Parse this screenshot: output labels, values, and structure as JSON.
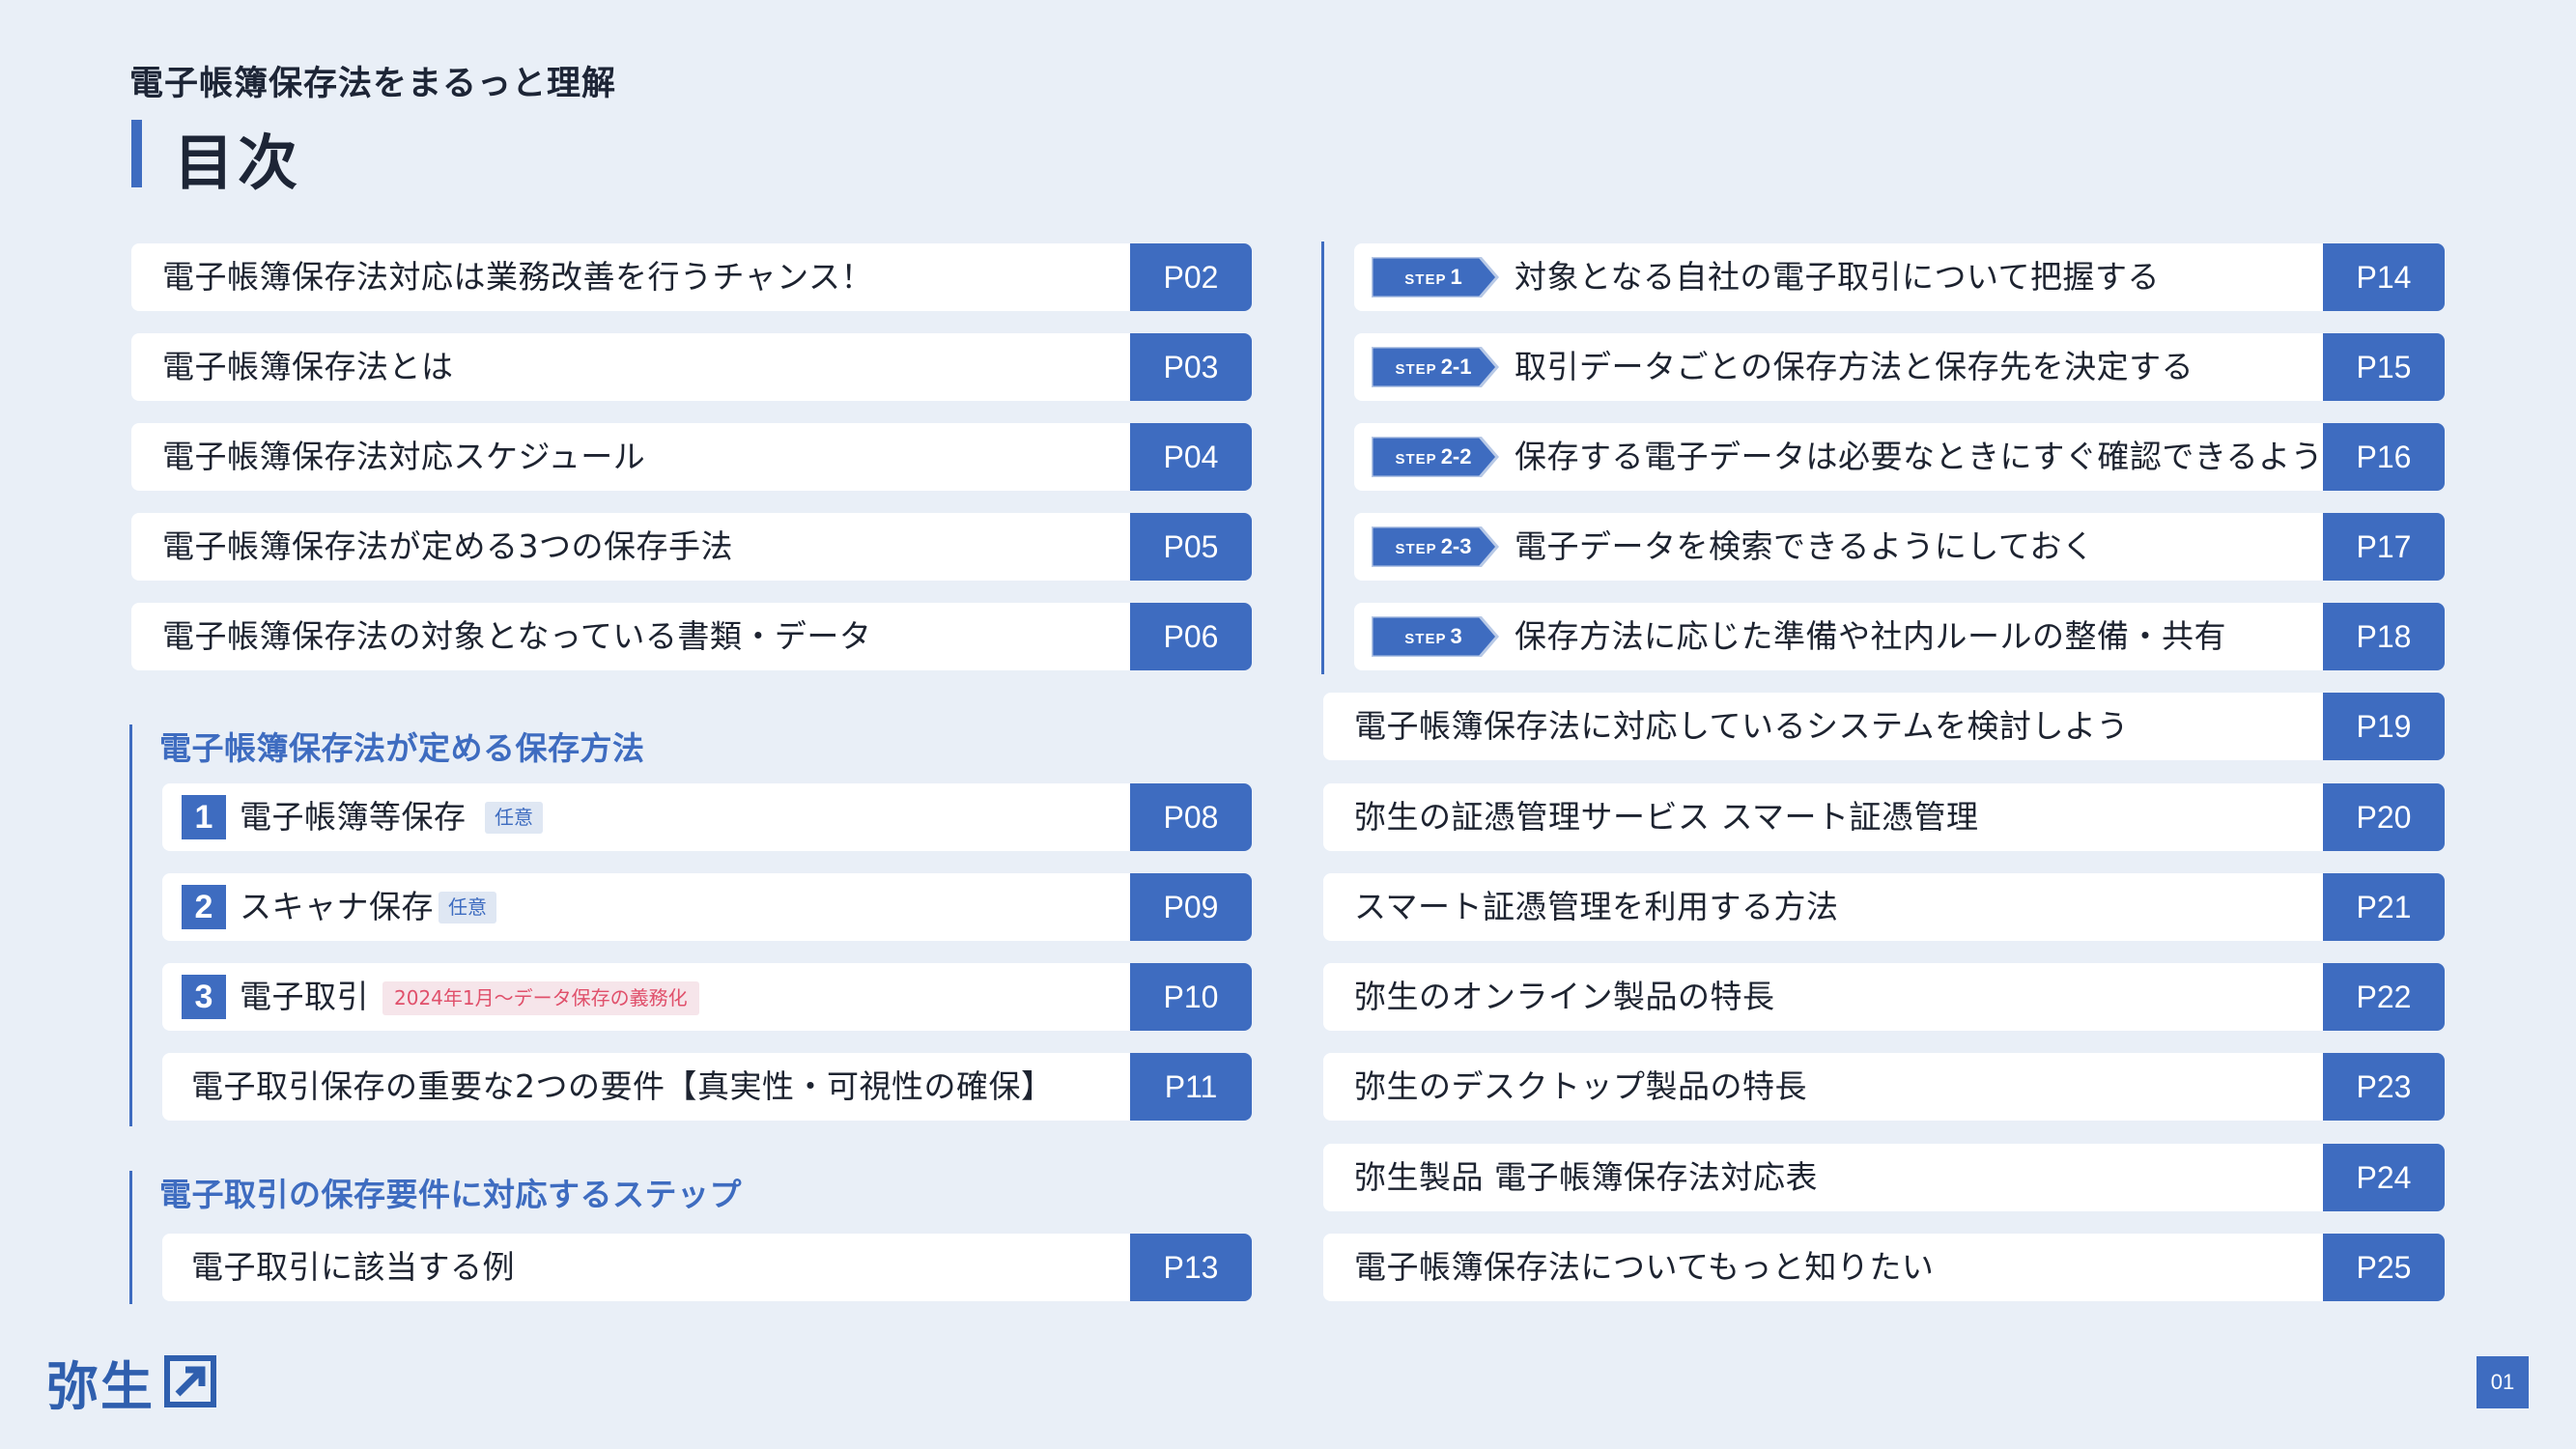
{
  "header": {
    "subtitle": "電子帳簿保存法をまるっと理解",
    "title": "目次"
  },
  "left": {
    "items": [
      {
        "label": "電子帳簿保存法対応は業務改善を行うチャンス！",
        "page": "P02"
      },
      {
        "label": "電子帳簿保存法とは",
        "page": "P03"
      },
      {
        "label": "電子帳簿保存法対応スケジュール",
        "page": "P04"
      },
      {
        "label": "電子帳簿保存法が定める3つの保存手法",
        "page": "P05"
      },
      {
        "label": "電子帳簿保存法の対象となっている書類・データ",
        "page": "P06"
      }
    ],
    "section1": {
      "heading": "電子帳簿保存法が定める保存方法",
      "items": [
        {
          "num": "1",
          "label": "電子帳簿等保存",
          "tag": "任意",
          "page": "P08"
        },
        {
          "num": "2",
          "label": "スキャナ保存",
          "tag": "任意",
          "page": "P09"
        },
        {
          "num": "3",
          "label": "電子取引",
          "tag": "2024年1月〜データ保存の義務化",
          "page": "P10"
        },
        {
          "label": "電子取引保存の重要な2つの要件【真実性・可視性の確保】",
          "page": "P11"
        }
      ]
    },
    "section2": {
      "heading": "電子取引の保存要件に対応するステップ",
      "items": [
        {
          "label": "電子取引に該当する例",
          "page": "P13"
        }
      ]
    }
  },
  "right": {
    "steps": [
      {
        "step_word": "STEP",
        "step_num": "1",
        "label": "対象となる自社の電子取引について把握する",
        "page": "P14"
      },
      {
        "step_word": "STEP",
        "step_num": "2-1",
        "label": "取引データごとの保存方法と保存先を決定する",
        "page": "P15"
      },
      {
        "step_word": "STEP",
        "step_num": "2-2",
        "label": "保存する電子データは必要なときにすぐ確認できるようにする",
        "page": "P16"
      },
      {
        "step_word": "STEP",
        "step_num": "2-3",
        "label": "電子データを検索できるようにしておく",
        "page": "P17"
      },
      {
        "step_word": "STEP",
        "step_num": "3",
        "label": "保存方法に応じた準備や社内ルールの整備・共有",
        "page": "P18"
      }
    ],
    "items": [
      {
        "label": "電子帳簿保存法に対応しているシステムを検討しよう",
        "page": "P19"
      },
      {
        "label": "弥生の証憑管理サービス スマート証憑管理",
        "page": "P20"
      },
      {
        "label": "スマート証憑管理を利用する方法",
        "page": "P21"
      },
      {
        "label": "弥生のオンライン製品の特長",
        "page": "P22"
      },
      {
        "label": "弥生のデスクトップ製品の特長",
        "page": "P23"
      },
      {
        "label": "弥生製品 電子帳簿保存法対応表",
        "page": "P24"
      },
      {
        "label": "電子帳簿保存法についてもっと知りたい",
        "page": "P25"
      }
    ]
  },
  "footer": {
    "logo_text": "弥生",
    "page_number": "01"
  },
  "colors": {
    "background": "#e9eff7",
    "accent": "#3e6cc0",
    "required_tag": "#e0506b"
  }
}
